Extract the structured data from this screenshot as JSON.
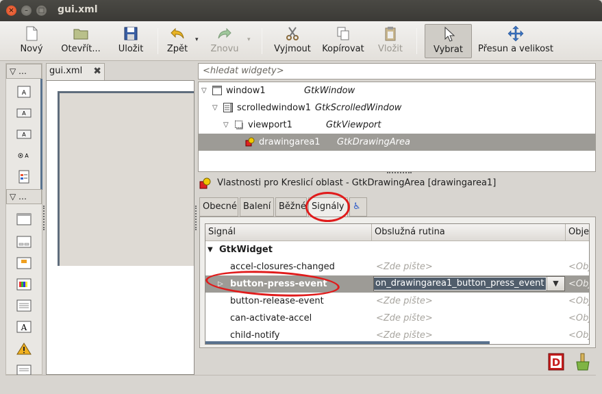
{
  "window": {
    "title": "gui.xml",
    "controls": {
      "close": "×",
      "minimize": "–",
      "maximize": "□"
    }
  },
  "toolbar": {
    "new": "Nový",
    "open": "Otevřít...",
    "save": "Uložit",
    "undo": "Zpět",
    "redo": "Znovu",
    "cut": "Vyjmout",
    "copy": "Kopírovat",
    "paste": "Vložit",
    "select": "Vybrat",
    "drag_resize": "Přesun a velikost",
    "dropdown_arrow": "▾"
  },
  "palette": {
    "group1": "▽ …",
    "group2": "▽ …"
  },
  "designer": {
    "tab_label": "gui.xml",
    "close_glyph": "✖"
  },
  "search": {
    "placeholder": "<hledat widgety>"
  },
  "tree": {
    "rows": [
      {
        "name": "window1",
        "type": "GtkWindow",
        "expander": "▽"
      },
      {
        "name": "scrolledwindow1",
        "type": "GtkScrolledWindow",
        "expander": "▽"
      },
      {
        "name": "viewport1",
        "type": "GtkViewport",
        "expander": "▽"
      },
      {
        "name": "drawingarea1",
        "type": "GtkDrawingArea",
        "expander": ""
      }
    ]
  },
  "properties": {
    "title": "Vlastnosti pro Kreslicí oblast - GtkDrawingArea [drawingarea1]",
    "tabs": {
      "general": "Obecné",
      "packing": "Balení",
      "common": "Běžné",
      "signals": "Signály",
      "accessibility": "♿"
    }
  },
  "signals": {
    "headers": {
      "signal": "Signál",
      "handler": "Obslužná rutina",
      "object": "Obje"
    },
    "group": {
      "expander": "▼",
      "name": "GtkWidget"
    },
    "rows": [
      {
        "signal": "accel-closures-changed",
        "handler": "<Zde pište>",
        "object": "<Obj"
      },
      {
        "signal": "button-press-event",
        "handler": "on_drawingarea1_button_press_event",
        "object": "<Obj",
        "expander": "▷"
      },
      {
        "signal": "button-release-event",
        "handler": "<Zde pište>",
        "object": "<Obj"
      },
      {
        "signal": "can-activate-accel",
        "handler": "<Zde pište>",
        "object": "<Obj"
      },
      {
        "signal": "child-notify",
        "handler": "<Zde pište>",
        "object": "<Obj"
      }
    ],
    "combo_arrow": "▼"
  },
  "colors": {
    "selection": "#9d9b96",
    "annotation": "#e01b1b",
    "accent_bar": "#59728e"
  }
}
